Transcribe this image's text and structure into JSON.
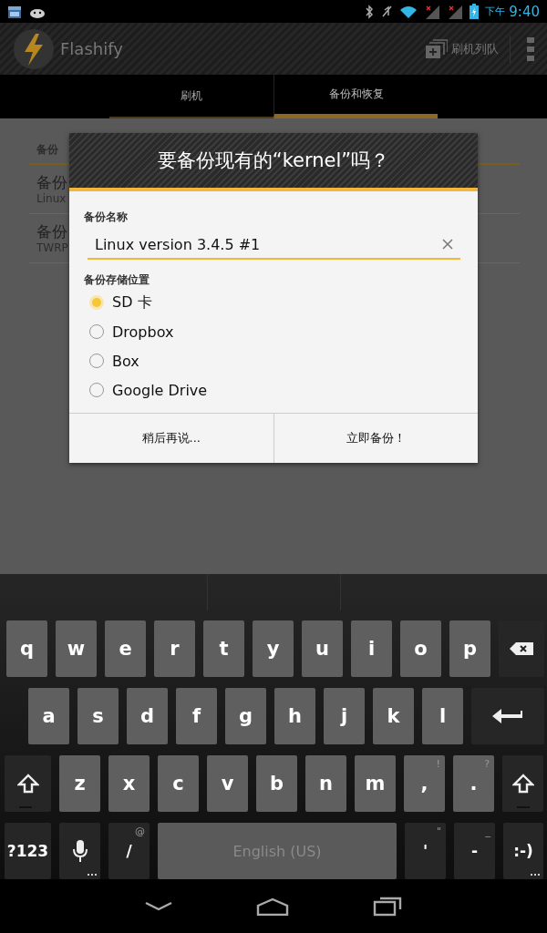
{
  "status_bar": {
    "period": "下午",
    "time": "9:40"
  },
  "action_bar": {
    "title": "Flashify",
    "action": "刷机列队"
  },
  "tabs": [
    {
      "label": "刷机",
      "selected": false
    },
    {
      "label": "备份和恢复",
      "selected": true
    }
  ],
  "background_list": {
    "section": "备份",
    "items": [
      {
        "title": "备份",
        "subtitle": "Linux"
      },
      {
        "title": "备份",
        "subtitle": "TWRP"
      }
    ]
  },
  "dialog": {
    "title": "要备份现有的“kernel”吗？",
    "name_label": "备份名称",
    "name_value": "Linux version 3.4.5 #1",
    "location_label": "备份存储位置",
    "locations": [
      {
        "label": "SD 卡",
        "selected": true
      },
      {
        "label": "Dropbox",
        "selected": false
      },
      {
        "label": "Box",
        "selected": false
      },
      {
        "label": "Google Drive",
        "selected": false
      }
    ],
    "buttons": [
      "稍后再说...",
      "立即备份！"
    ]
  },
  "keyboard": {
    "rows": [
      {
        "keys": [
          {
            "kind": "char",
            "label": "q"
          },
          {
            "kind": "char",
            "label": "w"
          },
          {
            "kind": "char",
            "label": "e"
          },
          {
            "kind": "char",
            "label": "r"
          },
          {
            "kind": "char",
            "label": "t"
          },
          {
            "kind": "char",
            "label": "y"
          },
          {
            "kind": "char",
            "label": "u"
          },
          {
            "kind": "char",
            "label": "i"
          },
          {
            "kind": "char",
            "label": "o"
          },
          {
            "kind": "char",
            "label": "p"
          },
          {
            "kind": "backspace"
          }
        ]
      },
      {
        "keys": [
          {
            "kind": "char",
            "label": "a"
          },
          {
            "kind": "char",
            "label": "s"
          },
          {
            "kind": "char",
            "label": "d"
          },
          {
            "kind": "char",
            "label": "f"
          },
          {
            "kind": "char",
            "label": "g"
          },
          {
            "kind": "char",
            "label": "h"
          },
          {
            "kind": "char",
            "label": "j"
          },
          {
            "kind": "char",
            "label": "k"
          },
          {
            "kind": "char",
            "label": "l"
          },
          {
            "kind": "enter"
          }
        ]
      },
      {
        "keys": [
          {
            "kind": "shift"
          },
          {
            "kind": "char",
            "label": "z"
          },
          {
            "kind": "char",
            "label": "x"
          },
          {
            "kind": "char",
            "label": "c"
          },
          {
            "kind": "char",
            "label": "v"
          },
          {
            "kind": "char",
            "label": "b"
          },
          {
            "kind": "char",
            "label": "n"
          },
          {
            "kind": "char",
            "label": "m"
          },
          {
            "kind": "char",
            "label": ",",
            "hint": "!"
          },
          {
            "kind": "char",
            "label": ".",
            "hint": "?"
          },
          {
            "kind": "shift"
          }
        ]
      },
      {
        "keys": [
          {
            "kind": "func",
            "label": "?123"
          },
          {
            "kind": "mic",
            "more": true
          },
          {
            "kind": "func",
            "label": "/",
            "hint": "@"
          },
          {
            "kind": "space",
            "label": "English (US)"
          },
          {
            "kind": "func",
            "label": "'",
            "hint": "\""
          },
          {
            "kind": "func",
            "label": "-",
            "hint": "_"
          },
          {
            "kind": "func",
            "label": ":-)",
            "more": true
          }
        ]
      }
    ]
  }
}
